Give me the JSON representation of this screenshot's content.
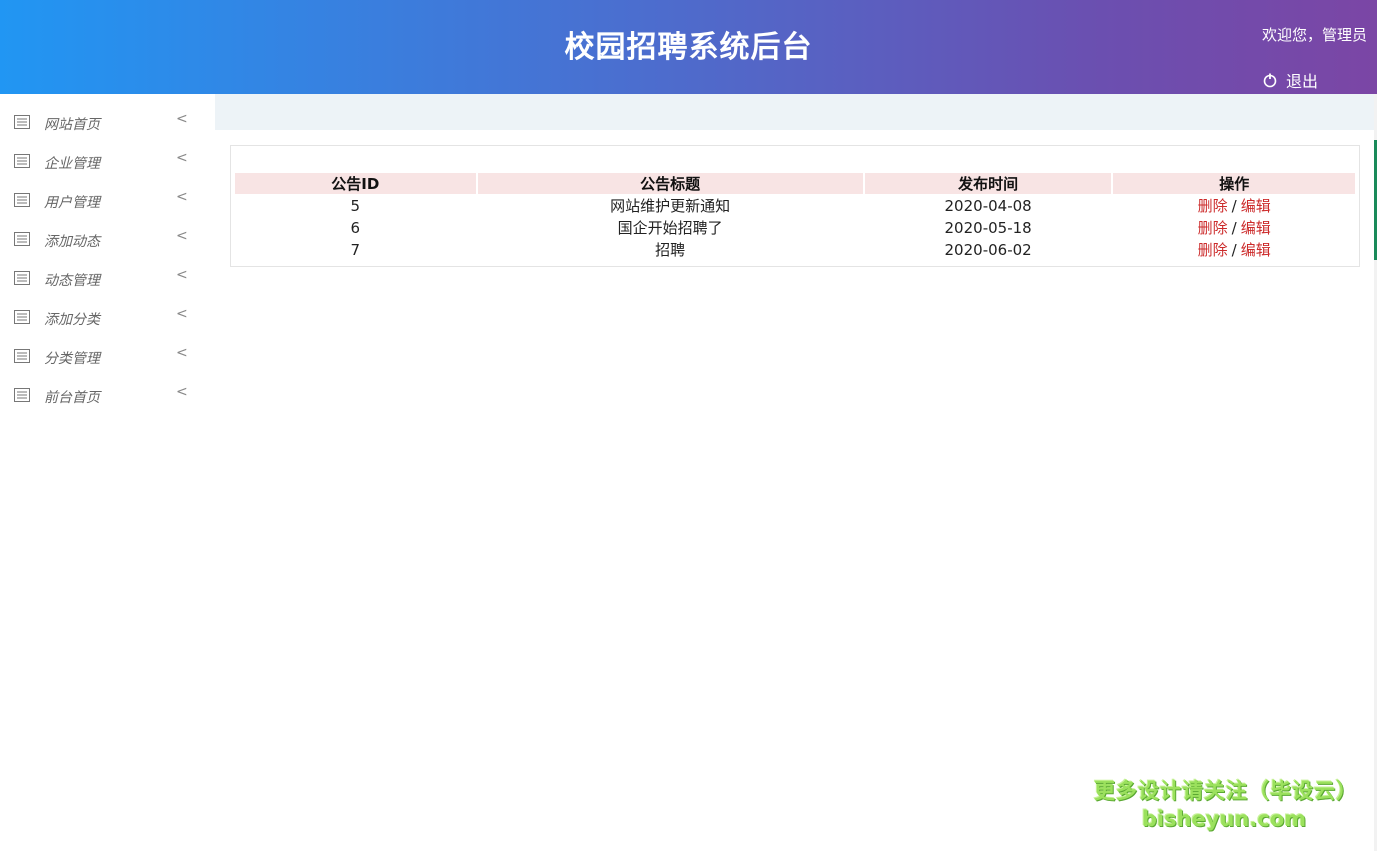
{
  "header": {
    "title": "校园招聘系统后台",
    "welcome": "欢迎您，管理员",
    "logout_label": "退出"
  },
  "sidebar": {
    "items": [
      {
        "label": "网站首页"
      },
      {
        "label": "企业管理"
      },
      {
        "label": "用户管理"
      },
      {
        "label": "添加动态"
      },
      {
        "label": "动态管理"
      },
      {
        "label": "添加分类"
      },
      {
        "label": "分类管理"
      },
      {
        "label": "前台首页"
      }
    ]
  },
  "table": {
    "headers": [
      "公告ID",
      "公告标题",
      "发布时间",
      "操作"
    ],
    "rows": [
      {
        "id": "5",
        "title": "网站维护更新通知",
        "date": "2020-04-08",
        "delete": "删除",
        "sep": "/",
        "edit": "编辑"
      },
      {
        "id": "6",
        "title": "国企开始招聘了",
        "date": "2020-05-18",
        "delete": "删除",
        "sep": "/",
        "edit": "编辑"
      },
      {
        "id": "7",
        "title": "招聘",
        "date": "2020-06-02",
        "delete": "删除",
        "sep": "/",
        "edit": "编辑"
      }
    ]
  },
  "watermark": {
    "line1": "更多设计请关注（毕设云）",
    "line2": "bisheyun.com"
  },
  "colors": {
    "header_gradient_start": "#2196f3",
    "header_gradient_end": "#7b46a5",
    "table_header_bg": "#f8e4e4",
    "link_red": "#cc2a2a",
    "watermark_green": "#9be15d"
  }
}
